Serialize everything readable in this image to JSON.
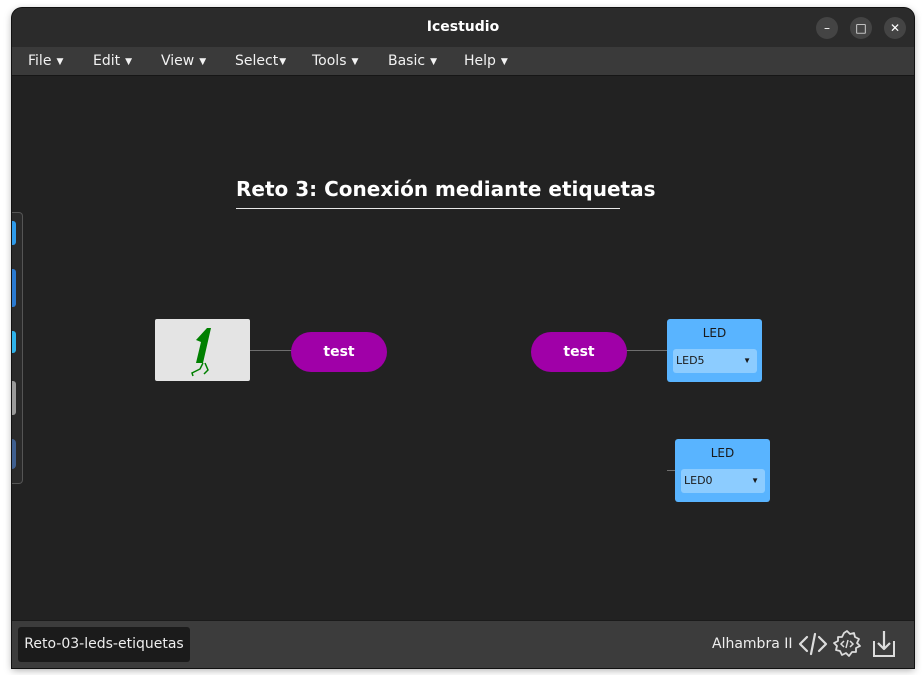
{
  "window": {
    "title": "Icestudio",
    "controls": {
      "minimize": "–",
      "maximize": "□",
      "close": "✕"
    }
  },
  "menubar": {
    "items": [
      {
        "label": "File"
      },
      {
        "label": "Edit"
      },
      {
        "label": "View"
      },
      {
        "label": "Select"
      },
      {
        "label": "Tools"
      },
      {
        "label": "Basic"
      },
      {
        "label": "Help"
      }
    ],
    "caret": "▼"
  },
  "canvas": {
    "heading": "Reto 3: Conexión mediante etiquetas",
    "constant_block": {
      "value": "1",
      "icon": "constant-one-icon"
    },
    "output_tag": {
      "label": "test"
    },
    "input_tag": {
      "label": "test"
    },
    "led_blocks": [
      {
        "title": "LED",
        "selected_pin": "LED5"
      },
      {
        "title": "LED",
        "selected_pin": "LED0"
      }
    ],
    "dropdown_arrow": "▼"
  },
  "footer": {
    "file_name": "Reto-03-leds-etiquetas",
    "board": "Alhambra II",
    "icons": [
      "code-icon",
      "build-settings-icon",
      "upload-icon"
    ]
  },
  "colors": {
    "canvas_bg": "#222222",
    "tag_purple": "#a000a8",
    "led_blue": "#59b4ff",
    "constant_green": "#008000"
  }
}
